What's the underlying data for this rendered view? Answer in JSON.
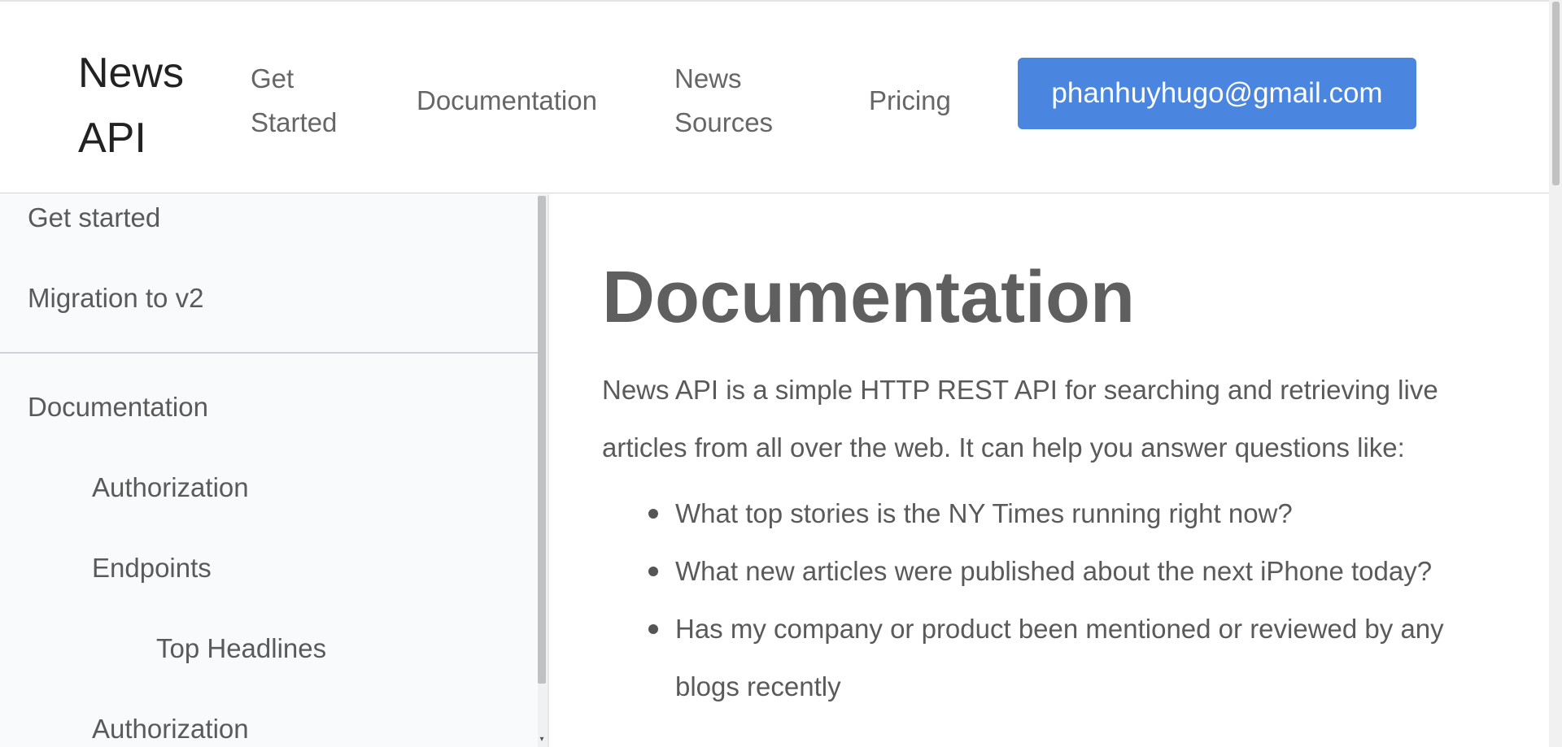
{
  "header": {
    "logo": "News API",
    "nav": {
      "get_started": "Get Started",
      "documentation": "Documentation",
      "news_sources": "News Sources",
      "pricing": "Pricing"
    },
    "account_email": "phanhuyhugo@gmail.com"
  },
  "sidebar": {
    "items": [
      {
        "label": "Get started"
      },
      {
        "label": "Migration to v2"
      },
      {
        "label": "Documentation"
      },
      {
        "label": "Authorization"
      },
      {
        "label": "Endpoints"
      },
      {
        "label": "Top Headlines"
      },
      {
        "label": "Authorization"
      }
    ]
  },
  "main": {
    "title": "Documentation",
    "intro": "News API is a simple HTTP REST API for searching and retrieving live articles from all over the web. It can help you answer questions like:",
    "questions": [
      "What top stories is the NY Times running right now?",
      "What new articles were published about the next iPhone today?",
      "Has my company or product been mentioned or reviewed by any blogs recently"
    ]
  },
  "colors": {
    "accent": "#4a86e0",
    "sidebar_bg": "#f9fafc",
    "text": "#5a5a5a"
  },
  "icons": {
    "scroll_down": "scroll-down-arrow-icon"
  }
}
